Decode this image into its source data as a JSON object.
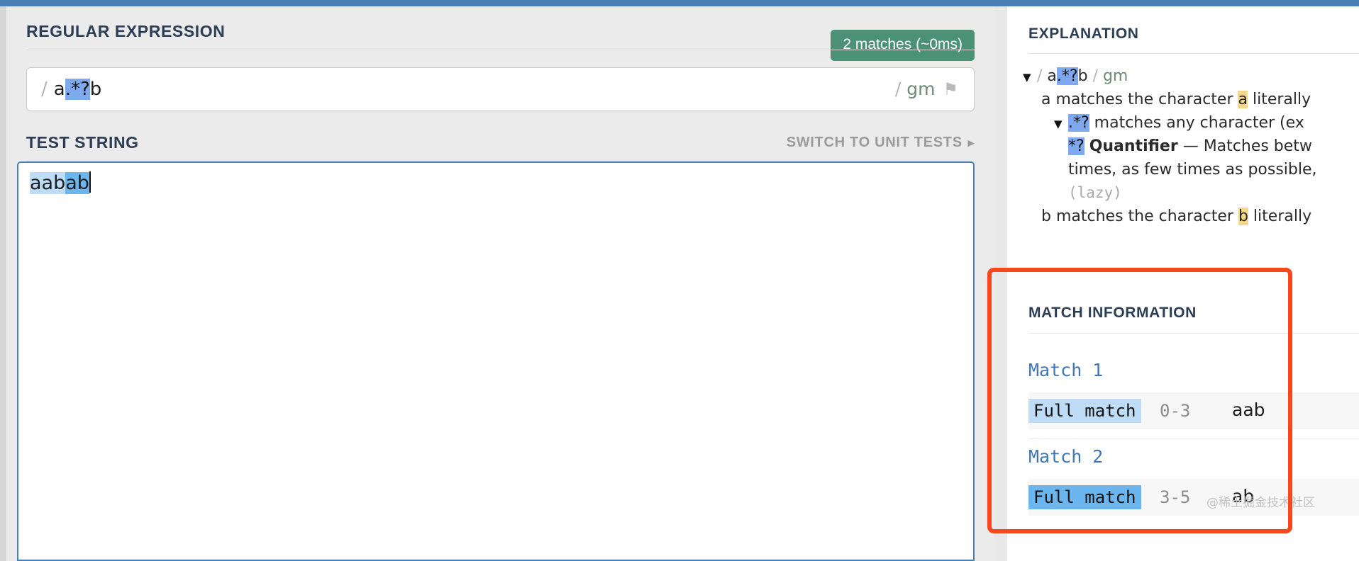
{
  "theme": {
    "top_bar_color": "#4a7fb5",
    "badge_color": "#4a9178",
    "title_color": "#2c3e55",
    "annotation_color": "#f8471a",
    "highlight_blue_light": "#bfdcf7",
    "highlight_blue_dark": "#6cb6f0",
    "selection_blue": "#7fa9ef",
    "highlight_yellow": "#f5d98b"
  },
  "regex_section": {
    "title": "REGULAR EXPRESSION",
    "match_badge": "2 matches (~0ms)",
    "leading_slash": "/",
    "pattern_prefix": "a",
    "pattern_selected": ".*?",
    "pattern_suffix": "b",
    "flag_slash": "/",
    "flags": "gm",
    "flag_icon": "flag-icon"
  },
  "test_string_section": {
    "title": "TEST STRING",
    "switch_label": "SWITCH TO UNIT TESTS",
    "switch_caret": "▸",
    "text_match1": "aab",
    "text_match2": "ab"
  },
  "explanation": {
    "title": "EXPLANATION",
    "triangle": "▼",
    "line1": {
      "slash1": "/",
      "pre": "a",
      "sel": ".*?",
      "post": "b",
      "slash2": "/",
      "flags": "gm"
    },
    "line2": {
      "code": "a",
      "text_before": " matches the character ",
      "token": "a",
      "text_after": " literally"
    },
    "line3": {
      "sel": ".*?",
      "text": " matches any character (ex"
    },
    "line4": {
      "sel": "*?",
      "bold": "Quantifier",
      "text": " — Matches betw"
    },
    "line5": "times, as few times as possible,",
    "line6": "(lazy)",
    "line7": {
      "code": "b",
      "text_before": " matches the character ",
      "token": "b",
      "text_after": " literally"
    }
  },
  "match_information": {
    "title": "MATCH INFORMATION",
    "matches": [
      {
        "label": "Match 1",
        "kind": "Full match",
        "range": "0-3",
        "value": "aab",
        "highlight": "light"
      },
      {
        "label": "Match 2",
        "kind": "Full match",
        "range": "3-5",
        "value": "ab",
        "highlight": "dark"
      }
    ],
    "watermark": "@稀土掘金技术社区"
  }
}
